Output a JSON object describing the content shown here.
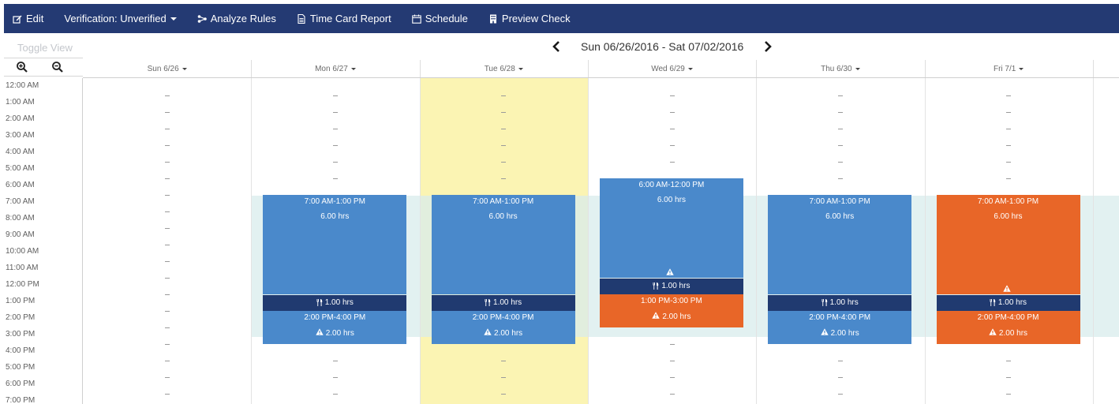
{
  "toolbar": {
    "edit": "Edit",
    "verification": "Verification: Unverified",
    "analyze": "Analyze Rules",
    "timecard": "Time Card Report",
    "schedule": "Schedule",
    "preview": "Preview Check",
    "bg_color": "#243a73"
  },
  "view": {
    "toggle": "Toggle View",
    "week_range": "Sun 06/26/2016 - Sat 07/02/2016",
    "prev_icon": "chevron-left-icon",
    "next_icon": "chevron-right-icon"
  },
  "days": [
    {
      "label": "Sun 6/26",
      "today": false
    },
    {
      "label": "Mon 6/27",
      "today": false
    },
    {
      "label": "Tue 6/28",
      "today": true
    },
    {
      "label": "Wed 6/29",
      "today": false
    },
    {
      "label": "Thu 6/30",
      "today": false
    },
    {
      "label": "Fri 7/1",
      "today": false
    }
  ],
  "times": [
    "12:00 AM",
    "1:00 AM",
    "2:00 AM",
    "3:00 AM",
    "4:00 AM",
    "5:00 AM",
    "6:00 AM",
    "7:00 AM",
    "8:00 AM",
    "9:00 AM",
    "10:00 AM",
    "11:00 AM",
    "12:00 PM",
    "1:00 PM",
    "2:00 PM",
    "3:00 PM",
    "4:00 PM",
    "5:00 PM",
    "6:00 PM",
    "7:00 PM"
  ],
  "empty_marker": "–",
  "colors": {
    "normal": "#4a89cb",
    "exception": "#e86628",
    "break": "#203a70",
    "today": "#fbf4b3",
    "band": "#d8ecec"
  },
  "shifts": [
    {
      "day": 1,
      "start": 7,
      "end": 13,
      "time": "7:00 AM-1:00 PM",
      "hours": "6.00 hrs",
      "status": "normal",
      "warning": false
    },
    {
      "day": 1,
      "start": 13,
      "end": 14,
      "type": "break",
      "hours": "1.00 hrs"
    },
    {
      "day": 1,
      "start": 14,
      "end": 16,
      "time": "2:00 PM-4:00 PM",
      "hours": "2.00 hrs",
      "status": "normal",
      "warning": true
    },
    {
      "day": 2,
      "start": 7,
      "end": 13,
      "time": "7:00 AM-1:00 PM",
      "hours": "6.00 hrs",
      "status": "normal",
      "warning": false
    },
    {
      "day": 2,
      "start": 13,
      "end": 14,
      "type": "break",
      "hours": "1.00 hrs"
    },
    {
      "day": 2,
      "start": 14,
      "end": 16,
      "time": "2:00 PM-4:00 PM",
      "hours": "2.00 hrs",
      "status": "normal",
      "warning": true
    },
    {
      "day": 3,
      "start": 6,
      "end": 12,
      "time": "6:00 AM-12:00 PM",
      "hours": "6.00 hrs",
      "status": "normal",
      "warning": true,
      "warning_only_icon": true
    },
    {
      "day": 3,
      "start": 12,
      "end": 13,
      "type": "break",
      "hours": "1.00 hrs"
    },
    {
      "day": 3,
      "start": 13,
      "end": 15,
      "time": "1:00 PM-3:00 PM",
      "hours": "2.00 hrs",
      "status": "exception",
      "warning": true
    },
    {
      "day": 4,
      "start": 7,
      "end": 13,
      "time": "7:00 AM-1:00 PM",
      "hours": "6.00 hrs",
      "status": "normal",
      "warning": false
    },
    {
      "day": 4,
      "start": 13,
      "end": 14,
      "type": "break",
      "hours": "1.00 hrs"
    },
    {
      "day": 4,
      "start": 14,
      "end": 16,
      "time": "2:00 PM-4:00 PM",
      "hours": "2.00 hrs",
      "status": "normal",
      "warning": true
    },
    {
      "day": 5,
      "start": 7,
      "end": 13,
      "time": "7:00 AM-1:00 PM",
      "hours": "6.00 hrs",
      "status": "exception",
      "warning": true,
      "warning_only_icon": true
    },
    {
      "day": 5,
      "start": 13,
      "end": 14,
      "type": "break",
      "hours": "1.00 hrs"
    },
    {
      "day": 5,
      "start": 14,
      "end": 16,
      "time": "2:00 PM-4:00 PM",
      "hours": "2.00 hrs",
      "status": "exception",
      "warning": true
    }
  ]
}
